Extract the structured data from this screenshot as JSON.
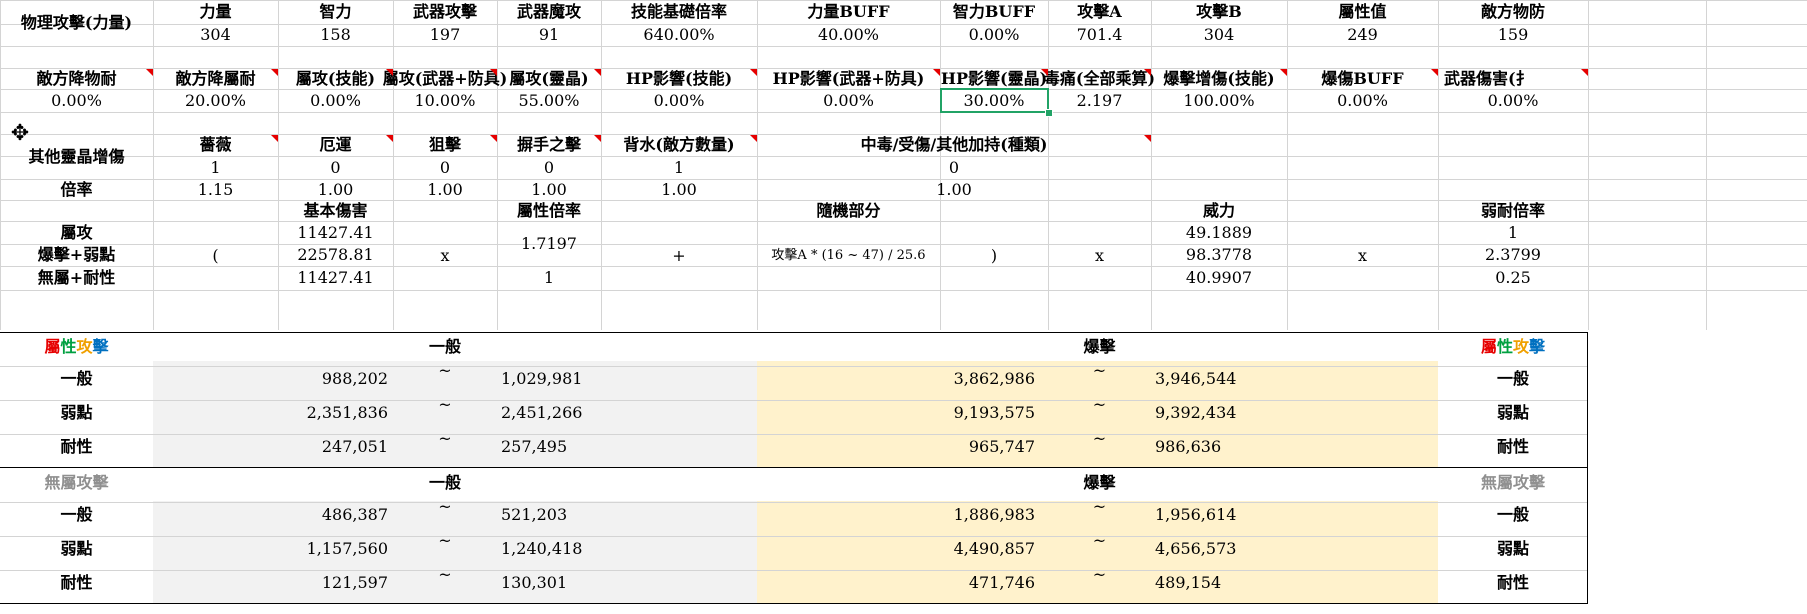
{
  "row1": {
    "title": "物理攻擊(力量)",
    "headers": [
      "力量",
      "智力",
      "武器攻擊",
      "武器魔攻",
      "技能基礎倍率",
      "力量BUFF",
      "智力BUFF",
      "攻擊A",
      "攻擊B",
      "屬性值",
      "敵方物防"
    ],
    "values": [
      "304",
      "158",
      "197",
      "91",
      "640.00%",
      "40.00%",
      "0.00%",
      "701.4",
      "304",
      "249",
      "159"
    ]
  },
  "row2": {
    "headers": [
      "敵方降物耐",
      "敵方降屬耐",
      "屬攻(技能)",
      "屬攻(武器+防具)",
      "屬攻(靈晶)",
      "HP影響(技能)",
      "HP影響(武器+防具)",
      "HP影響(靈晶)",
      "毒痛(全部乘算)",
      "爆擊增傷(技能)",
      "爆傷BUFF",
      "武器傷害(扌"
    ],
    "values": [
      "0.00%",
      "20.00%",
      "0.00%",
      "10.00%",
      "55.00%",
      "0.00%",
      "0.00%",
      "30.00%",
      "2.197",
      "100.00%",
      "0.00%",
      "0.00%"
    ]
  },
  "row3": {
    "title": "其他靈晶增傷",
    "rate_label": "倍率",
    "headers": [
      "薔薇",
      "厄運",
      "狙擊",
      "摒手之擊",
      "背水(敵方數量)",
      "中毒/受傷/其他加持(種類)"
    ],
    "counts": [
      "1",
      "0",
      "0",
      "0",
      "1",
      "0"
    ],
    "rates": [
      "1.15",
      "1.00",
      "1.00",
      "1.00",
      "1.00",
      "1.00"
    ]
  },
  "formula": {
    "row_labels": [
      "屬攻",
      "爆擊+弱點",
      "無屬+耐性"
    ],
    "open_paren": "(",
    "base_header": "基本傷害",
    "base_values": [
      "11427.41",
      "22578.81",
      "11427.41"
    ],
    "times1": "x",
    "attr_header": "屬性倍率",
    "attr_values": [
      "1.7197",
      "1"
    ],
    "plus": "+",
    "random_header": "隨機部分",
    "random_formula": "攻擊A * (16 ~ 47) / 25.6",
    "close_paren": ")",
    "times2": "x",
    "power_header": "威力",
    "power_values": [
      "49.1889",
      "98.3778",
      "40.9907"
    ],
    "times3": "x",
    "weak_header": "弱耐倍率",
    "weak_values": [
      "1",
      "2.3799",
      "0.25"
    ]
  },
  "attr_table": {
    "title_chars": [
      "屬",
      "性",
      "攻",
      "擊"
    ],
    "normal_header": "一般",
    "crit_header": "爆擊",
    "tilde": "~",
    "rows": [
      {
        "label": "一般",
        "n_min": "988,202",
        "n_max": "1,029,981",
        "c_min": "3,862,986",
        "c_max": "3,946,544"
      },
      {
        "label": "弱點",
        "n_min": "2,351,836",
        "n_max": "2,451,266",
        "c_min": "9,193,575",
        "c_max": "9,392,434"
      },
      {
        "label": "耐性",
        "n_min": "247,051",
        "n_max": "257,495",
        "c_min": "965,747",
        "c_max": "986,636"
      }
    ]
  },
  "nonattr_table": {
    "title": "無屬攻擊",
    "normal_header": "一般",
    "crit_header": "爆擊",
    "tilde": "~",
    "rows": [
      {
        "label": "一般",
        "n_min": "486,387",
        "n_max": "521,203",
        "c_min": "1,886,983",
        "c_max": "1,956,614"
      },
      {
        "label": "弱點",
        "n_min": "1,157,560",
        "n_max": "1,240,418",
        "c_min": "4,490,857",
        "c_max": "4,656,573"
      },
      {
        "label": "耐性",
        "n_min": "121,597",
        "n_max": "130,301",
        "c_min": "471,746",
        "c_max": "489,154"
      }
    ]
  },
  "colors": {
    "title_red": "#e60000",
    "title_green": "#00a040",
    "title_orange": "#f0a000",
    "title_blue": "#0070c0",
    "gray_fill": "#f2f2f2",
    "yellow_fill": "#fff2cc",
    "selection": "#21a366"
  }
}
